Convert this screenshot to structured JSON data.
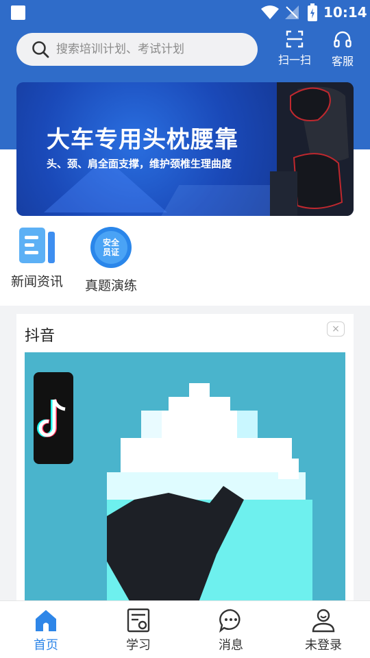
{
  "status_bar": {
    "time": "10:14"
  },
  "header": {
    "search_placeholder": "搜索培训计划、考试计划",
    "scan_label": "扫一扫",
    "service_label": "客服"
  },
  "banner": {
    "title": "大车专用头枕腰靠",
    "subtitle": "头、颈、肩全面支撑，维护颈椎生理曲度"
  },
  "quick_links": [
    {
      "label": "新闻资讯",
      "icon": "news-icon"
    },
    {
      "label": "真题演练",
      "icon": "safety-cert-icon",
      "badge_line1": "安全",
      "badge_line2": "员证"
    }
  ],
  "ad": {
    "title": "抖音",
    "close_label": "×"
  },
  "bottom_nav": [
    {
      "label": "首页",
      "icon": "home-icon",
      "active": true
    },
    {
      "label": "学习",
      "icon": "study-icon",
      "active": false
    },
    {
      "label": "消息",
      "icon": "message-icon",
      "active": false
    },
    {
      "label": "未登录",
      "icon": "user-icon",
      "active": false
    }
  ],
  "colors": {
    "primary": "#2f6cc9",
    "active_tab": "#2e86e8",
    "ad_bg": "#4ab4cc"
  }
}
